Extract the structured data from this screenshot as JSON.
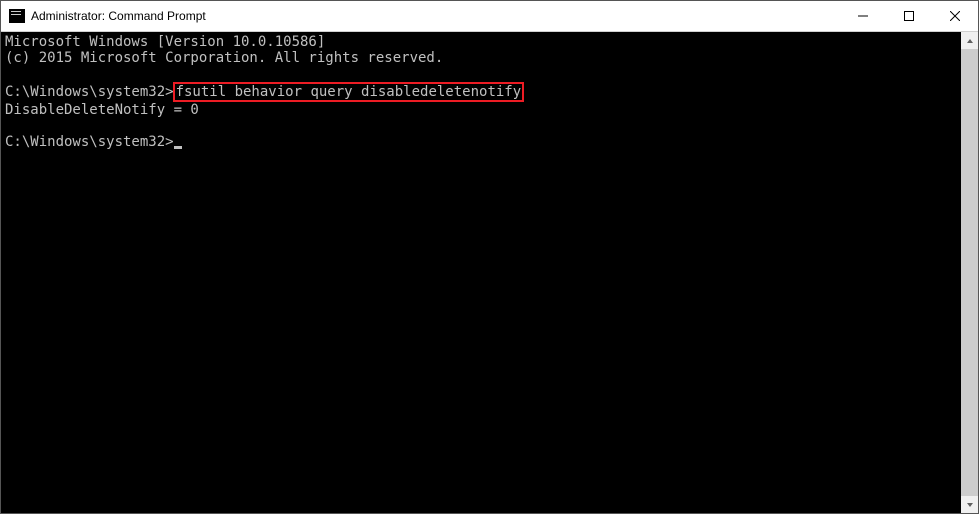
{
  "title": "Administrator: Command Prompt",
  "terminal": {
    "line1": "Microsoft Windows [Version 10.0.10586]",
    "line2": "(c) 2015 Microsoft Corporation. All rights reserved.",
    "prompt1_path": "C:\\Windows\\system32>",
    "command": "fsutil behavior query disabledeletenotify",
    "output": "DisableDeleteNotify = 0",
    "prompt2_path": "C:\\Windows\\system32>"
  }
}
